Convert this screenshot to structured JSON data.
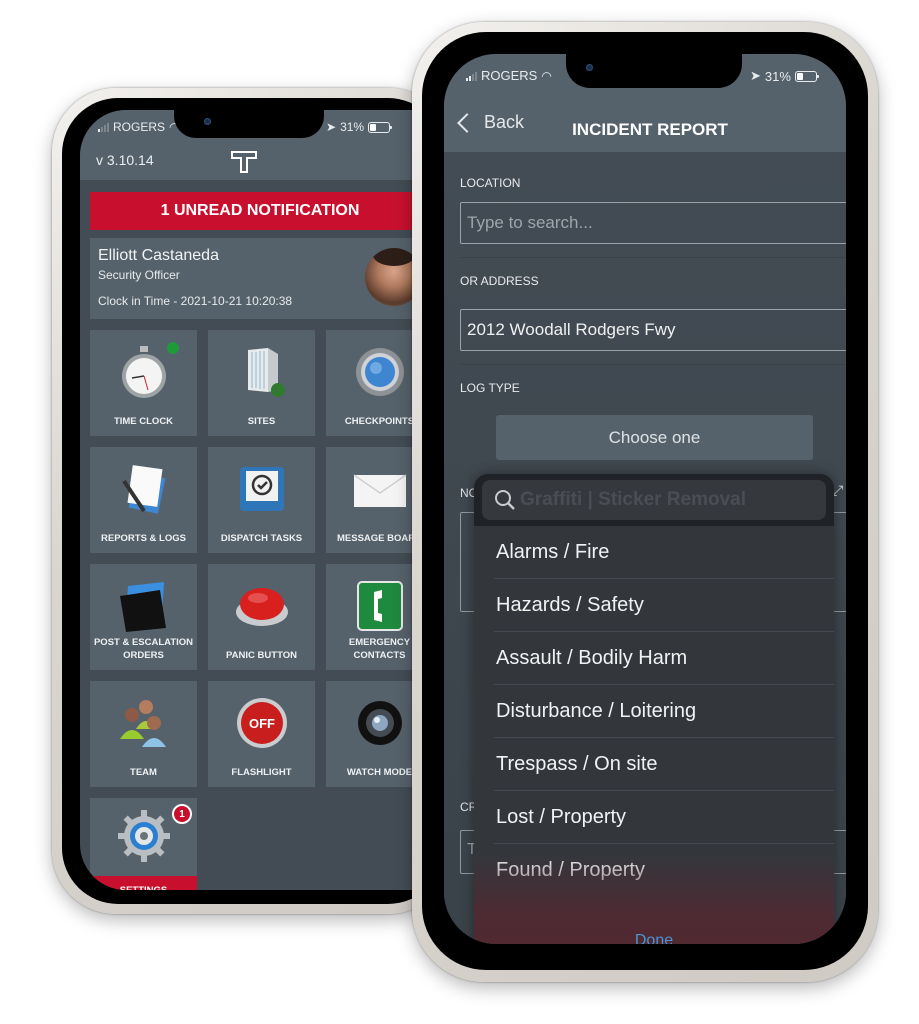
{
  "left_phone": {
    "status_bar": {
      "carrier": "ROGERS",
      "battery": "31%",
      "signal_bars_on": 1,
      "signal_bars_total": 4
    },
    "version": "v 3.10.14",
    "logo": "T",
    "notification_banner": "1 UNREAD NOTIFICATION",
    "user": {
      "name": "Elliott Castaneda",
      "role": "Security Officer",
      "clock_in": "Clock in Time - 2021-10-21 10:20:38"
    },
    "tiles": [
      {
        "label": "TIME CLOCK",
        "icon": "stopwatch-icon",
        "status": "online"
      },
      {
        "label": "SITES",
        "icon": "building-icon"
      },
      {
        "label": "CHECKPOINTS",
        "icon": "checkpoint-orb-icon"
      },
      {
        "label": "REPORTS & LOGS",
        "icon": "document-pen-icon"
      },
      {
        "label": "DISPATCH TASKS",
        "icon": "task-tray-icon"
      },
      {
        "label": "MESSAGE BOARD",
        "icon": "envelope-icon"
      },
      {
        "label": "POST & ESCALATION ORDERS",
        "icon": "folder-icon"
      },
      {
        "label": "PANIC BUTTON",
        "icon": "red-button-icon"
      },
      {
        "label": "EMERGENCY CONTACTS",
        "icon": "phone-sign-icon"
      },
      {
        "label": "TEAM",
        "icon": "team-icon"
      },
      {
        "label": "FLASHLIGHT",
        "icon": "flashlight-off-icon",
        "icon_text": "OFF"
      },
      {
        "label": "WATCH MODE",
        "icon": "camera-lens-icon"
      },
      {
        "label": "SETTINGS",
        "icon": "gear-icon",
        "badge": "1"
      }
    ]
  },
  "right_phone": {
    "status_bar": {
      "carrier": "ROGERS",
      "battery": "31%"
    },
    "header": {
      "back_label": "Back",
      "title": "INCIDENT REPORT"
    },
    "form": {
      "location_label": "LOCATION",
      "location_placeholder": "Type to search...",
      "address_label": "OR ADDRESS",
      "address_value": "2012 Woodall Rodgers Fwy",
      "log_type_label": "LOG TYPE",
      "log_type_button": "Choose one",
      "notes_label_partial": "NO",
      "cr_label_partial": "CR",
      "cr_input_partial": "T"
    },
    "picker": {
      "search_placeholder": "Graffiti | Sticker Removal",
      "options": [
        "Alarms / Fire",
        "Hazards / Safety",
        "Assault / Bodily Harm",
        "Disturbance / Loitering",
        "Trespass / On site",
        "Lost / Property",
        "Found / Property"
      ],
      "done_label": "Done"
    }
  },
  "colors": {
    "brand_red": "#c8102e",
    "panel_gray": "#56626b",
    "background_gray": "#434c54",
    "done_blue": "#4a93d4",
    "online_green": "#1f9a3a"
  }
}
